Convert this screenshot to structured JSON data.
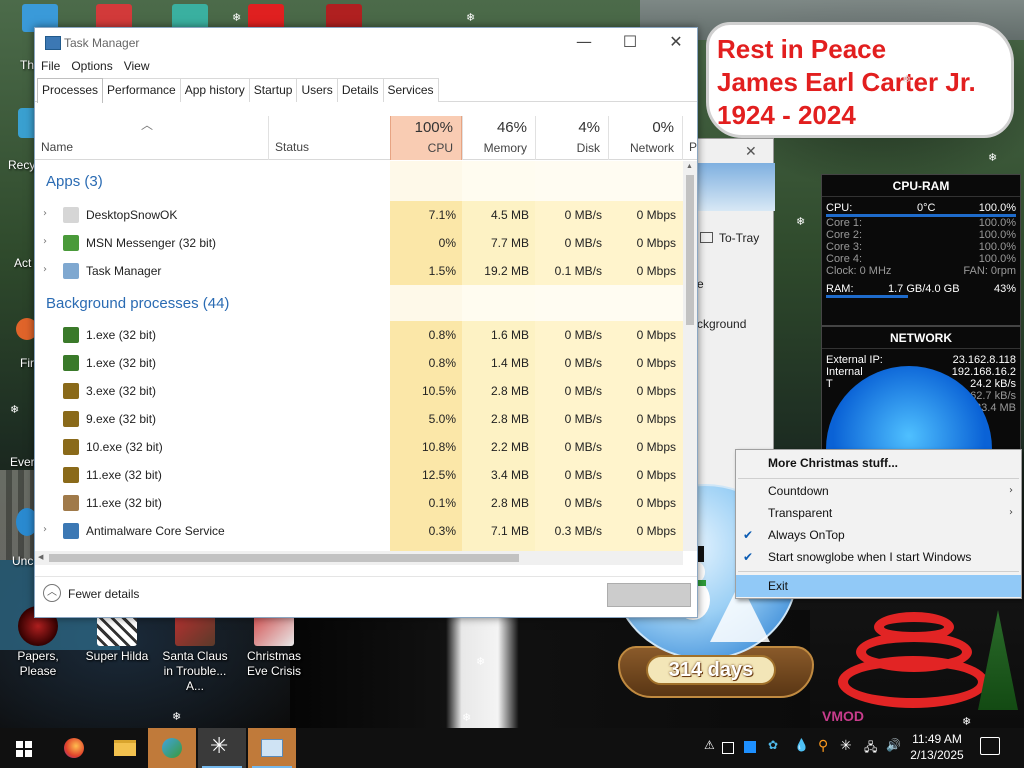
{
  "desktop": {
    "icons": [
      {
        "label": "Papers, Please"
      },
      {
        "label": "Super Hilda"
      },
      {
        "label": "Santa Claus in Trouble... A..."
      },
      {
        "label": "Christmas Eve Crisis"
      }
    ],
    "edge_labels": [
      "Th",
      "Recy",
      "Act",
      "Fir",
      "Ever",
      "Unc"
    ],
    "memorial": [
      "Rest in Peace",
      "James Earl Carter Jr.",
      "1924 - 2024"
    ]
  },
  "task_manager": {
    "title": "Task Manager",
    "menu": [
      "File",
      "Options",
      "View"
    ],
    "tabs": [
      "Processes",
      "Performance",
      "App history",
      "Startup",
      "Users",
      "Details",
      "Services"
    ],
    "active_tab": "Processes",
    "columns": {
      "name": "Name",
      "status": "Status",
      "cpu": {
        "pct": "100%",
        "label": "CPU"
      },
      "memory": {
        "pct": "46%",
        "label": "Memory"
      },
      "disk": {
        "pct": "4%",
        "label": "Disk"
      },
      "network": {
        "pct": "0%",
        "label": "Network"
      },
      "power": "P"
    },
    "groups": {
      "apps": "Apps (3)",
      "background": "Background processes (44)"
    },
    "apps": [
      {
        "name": "DesktopSnowOK",
        "cpu": "7.1%",
        "mem": "4.5 MB",
        "disk": "0 MB/s",
        "net": "0 Mbps"
      },
      {
        "name": "MSN Messenger (32 bit)",
        "cpu": "0%",
        "mem": "7.7 MB",
        "disk": "0 MB/s",
        "net": "0 Mbps"
      },
      {
        "name": "Task Manager",
        "cpu": "1.5%",
        "mem": "19.2 MB",
        "disk": "0.1 MB/s",
        "net": "0 Mbps"
      }
    ],
    "background": [
      {
        "name": "1.exe (32 bit)",
        "cpu": "0.8%",
        "mem": "1.6 MB",
        "disk": "0 MB/s",
        "net": "0 Mbps"
      },
      {
        "name": "1.exe (32 bit)",
        "cpu": "0.8%",
        "mem": "1.4 MB",
        "disk": "0 MB/s",
        "net": "0 Mbps"
      },
      {
        "name": "3.exe (32 bit)",
        "cpu": "10.5%",
        "mem": "2.8 MB",
        "disk": "0 MB/s",
        "net": "0 Mbps"
      },
      {
        "name": "9.exe (32 bit)",
        "cpu": "5.0%",
        "mem": "2.8 MB",
        "disk": "0 MB/s",
        "net": "0 Mbps"
      },
      {
        "name": "10.exe (32 bit)",
        "cpu": "10.8%",
        "mem": "2.2 MB",
        "disk": "0 MB/s",
        "net": "0 Mbps"
      },
      {
        "name": "11.exe (32 bit)",
        "cpu": "12.5%",
        "mem": "3.4 MB",
        "disk": "0 MB/s",
        "net": "0 Mbps"
      },
      {
        "name": "11.exe (32 bit)",
        "cpu": "0.1%",
        "mem": "2.8 MB",
        "disk": "0 MB/s",
        "net": "0 Mbps"
      },
      {
        "name": "Antimalware Core Service",
        "cpu": "0.3%",
        "mem": "7.1 MB",
        "disk": "0.3 MB/s",
        "net": "0 Mbps"
      }
    ],
    "fewer_details": "Fewer details"
  },
  "behind_window": {
    "to_tray": "To-Tray",
    "text_e": "e",
    "text_bg": "ckground"
  },
  "cpu_ram": {
    "title": "CPU-RAM",
    "cpu_label": "CPU:",
    "cpu_temp": "0°C",
    "cpu_val": "100.0%",
    "cores": [
      {
        "label": "Core 1:",
        "val": "100.0%"
      },
      {
        "label": "Core 2:",
        "val": "100.0%"
      },
      {
        "label": "Core 3:",
        "val": "100.0%"
      },
      {
        "label": "Core 4:",
        "val": "100.0%"
      }
    ],
    "clock": "Clock: 0 MHz",
    "fan": "FAN: 0rpm",
    "ram_label": "RAM:",
    "ram_val": "1.7 GB/4.0 GB",
    "ram_pct": "43%"
  },
  "network": {
    "title": "NETWORK",
    "ext_label": "External IP:",
    "ext_val": "23.162.8.118",
    "int_label": "Internal",
    "int_val": "192.168.16.2",
    "row3_label": "T",
    "row3_val": "24.2 kB/s",
    "row4_val": "62.7 kB/s",
    "row5_val": "23.4 MB"
  },
  "snowglobe": {
    "days": "314 days"
  },
  "context_menu": {
    "items": [
      {
        "label": "More Christmas stuff...",
        "checked": false,
        "submenu": false
      },
      {
        "label": "Countdown",
        "checked": false,
        "submenu": true
      },
      {
        "label": "Transparent",
        "checked": false,
        "submenu": true
      },
      {
        "label": "Always OnTop",
        "checked": true,
        "submenu": false
      },
      {
        "label": "Start snowglobe when I start Windows",
        "checked": true,
        "submenu": false
      },
      {
        "label": "Exit",
        "checked": false,
        "submenu": false
      }
    ]
  },
  "watermark": "VMOD",
  "taskbar": {
    "time": "11:49 AM",
    "date": "2/13/2025"
  },
  "colors": {
    "cpu_header": "#f9ccb3",
    "group_blue": "#2a6bb3",
    "memorial_red": "#e21f1f",
    "menu_highlight": "#91c9f7"
  }
}
